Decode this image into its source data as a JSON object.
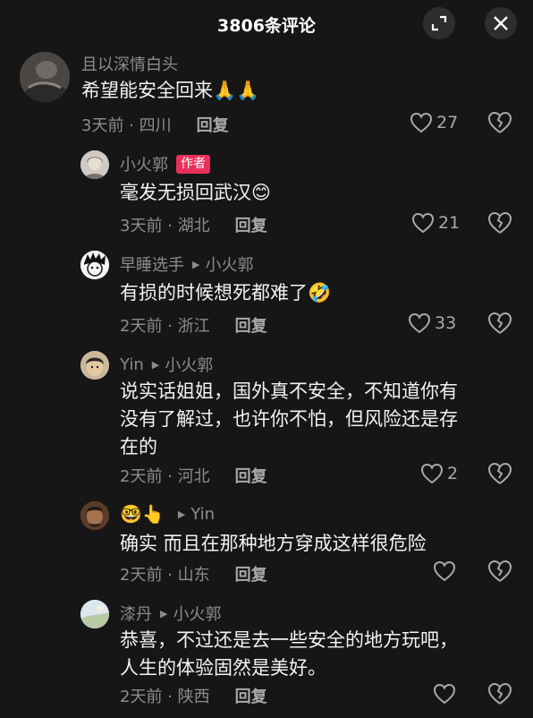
{
  "header": {
    "title": "3806条评论",
    "expand_icon": "expand-icon",
    "close_icon": "close-icon"
  },
  "comments": [
    {
      "user": "且以深情白头",
      "text_lines": [
        "希望能安全回来🙏🙏"
      ],
      "time_loc": "3天前 · 四川",
      "reply_label": "回复",
      "likes": "27"
    },
    {
      "user": "小火郭",
      "badge": "作者",
      "text_lines": [
        "毫发无损回武汉😊"
      ],
      "time_loc": "3天前 · 湖北",
      "reply_label": "回复",
      "likes": "21"
    },
    {
      "user": "早睡选手",
      "reply_to": "小火郭",
      "text_lines": [
        "有损的时候想死都难了🤣"
      ],
      "time_loc": "2天前 · 浙江",
      "reply_label": "回复",
      "likes": "33"
    },
    {
      "user": "Yin",
      "reply_to": "小火郭",
      "text_lines": [
        "说实话姐姐，国外真不安全，不知道你有",
        "没有了解过，也许你不怕，但风险还是存",
        "在的"
      ],
      "time_loc": "2天前 · 河北",
      "reply_label": "回复",
      "likes": "2"
    },
    {
      "user": "🤓👆",
      "reply_to": "Yin",
      "text_lines": [
        "确实  而且在那种地方穿成这样很危险"
      ],
      "time_loc": "2天前 · 山东",
      "reply_label": "回复",
      "likes": ""
    },
    {
      "user": "漆丹",
      "reply_to": "小火郭",
      "text_lines": [
        "恭喜，不过还是去一些安全的地方玩吧，",
        "人生的体验固然是美好。"
      ],
      "time_loc": "2天前 · 陕西",
      "reply_label": "回复",
      "likes": ""
    }
  ],
  "colors": {
    "background": "#161616",
    "author_badge": "#e8305a",
    "muted_text": "#8c8c8c"
  }
}
